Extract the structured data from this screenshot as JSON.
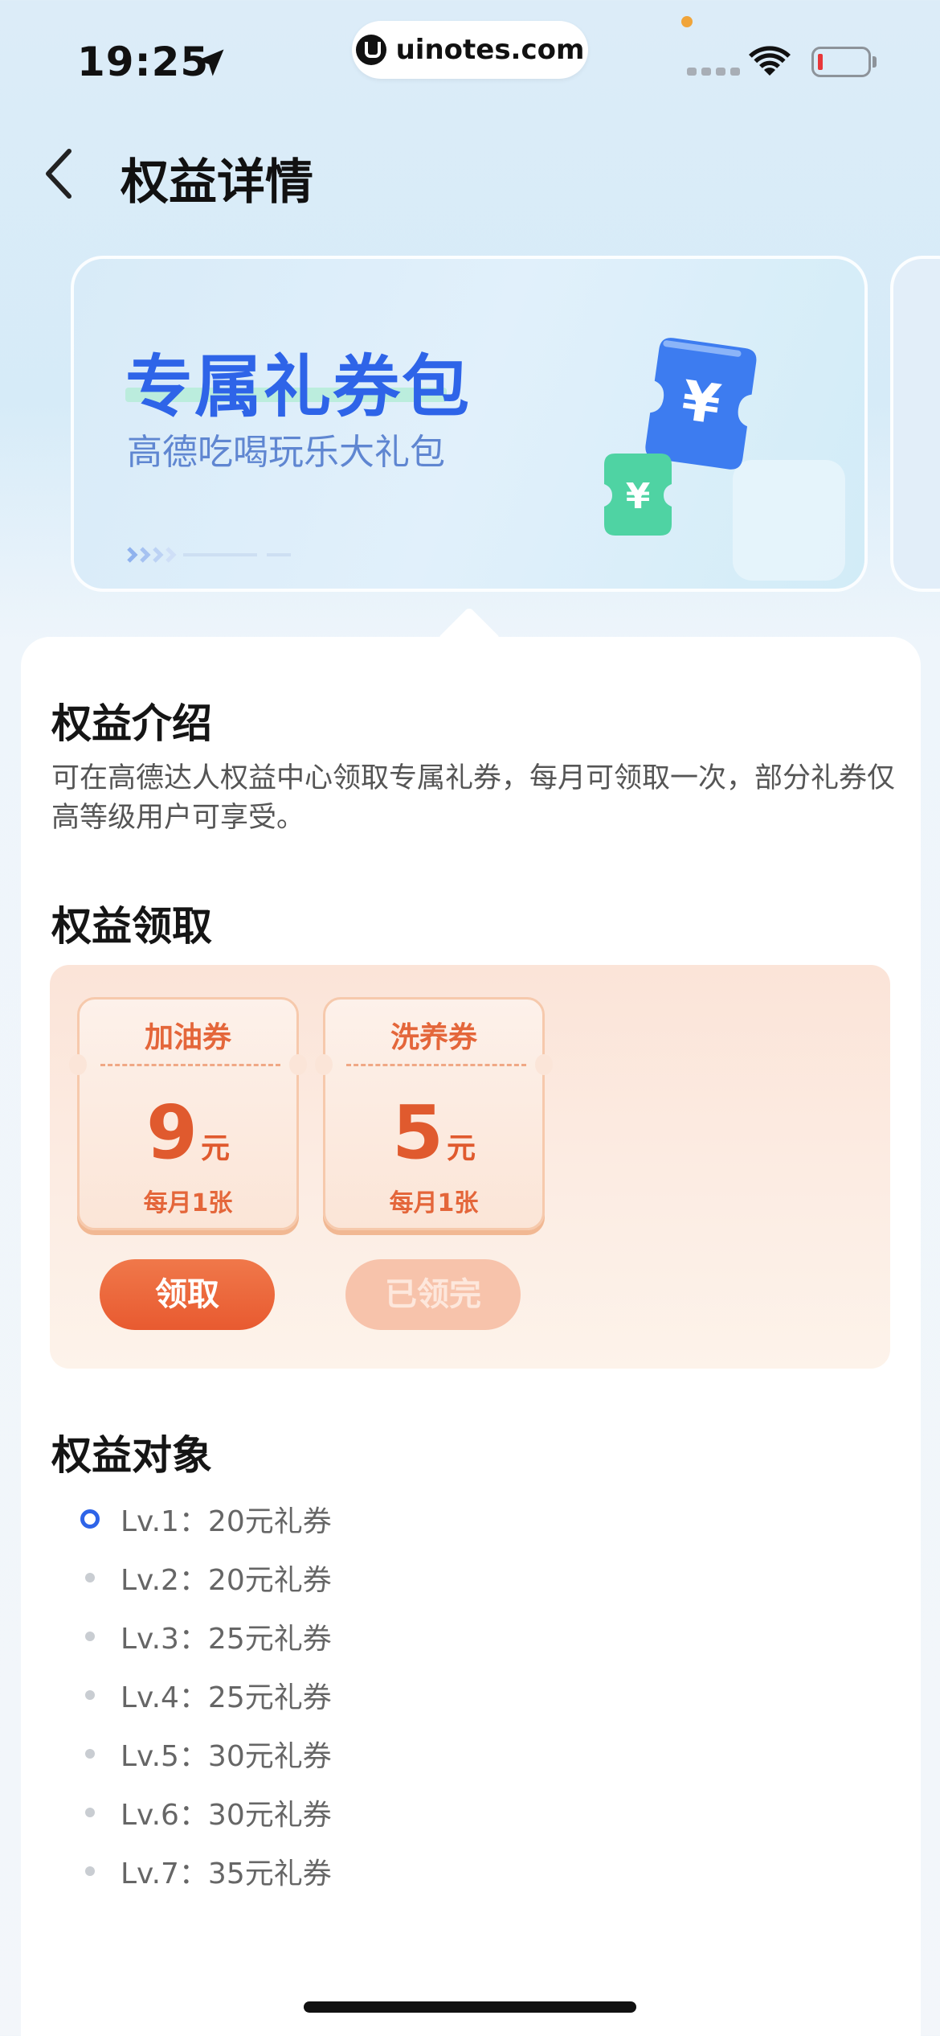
{
  "status_bar": {
    "time": "19:25",
    "url": "uinotes.com",
    "colors": {
      "battery_level": "#e8373a",
      "dot": "#f0a43a"
    }
  },
  "header": {
    "title": "权益详情",
    "back_icon": "chevron-left-icon"
  },
  "banner": {
    "title": "专属礼券包",
    "subtitle": "高德吃喝玩乐大礼包",
    "icon": "yen-coupon-icon",
    "colors": {
      "title": "#2e64e8",
      "subtitle": "#5f86d1"
    }
  },
  "intro": {
    "heading": "权益介绍",
    "text": "可在高德达人权益中心领取专属礼券，每月可领取一次，部分礼券仅高等级用户可享受。"
  },
  "claim": {
    "heading": "权益领取",
    "coupons": [
      {
        "name": "加油券",
        "amount": "9",
        "unit": "元",
        "limit": "每月1张",
        "button": "领取",
        "state": "available"
      },
      {
        "name": "洗养券",
        "amount": "5",
        "unit": "元",
        "limit": "每月1张",
        "button": "已领完",
        "state": "claimed"
      }
    ],
    "colors": {
      "accent": "#e85a30",
      "disabled": "#f7c3ab"
    }
  },
  "targets": {
    "heading": "权益对象",
    "levels": [
      {
        "label": "Lv.1：20元礼券",
        "active": true
      },
      {
        "label": "Lv.2：20元礼券",
        "active": false
      },
      {
        "label": "Lv.3：25元礼券",
        "active": false
      },
      {
        "label": "Lv.4：25元礼券",
        "active": false
      },
      {
        "label": "Lv.5：30元礼券",
        "active": false
      },
      {
        "label": "Lv.6：30元礼券",
        "active": false
      },
      {
        "label": "Lv.7：35元礼券",
        "active": false
      }
    ],
    "colors": {
      "active": "#2e64e8"
    }
  }
}
